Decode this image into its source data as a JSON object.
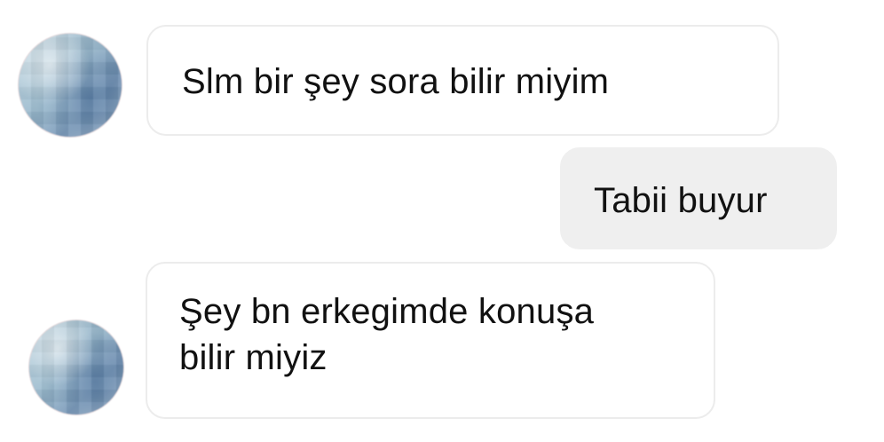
{
  "chat": {
    "messages": [
      {
        "direction": "incoming",
        "lines": [
          "Slm bir şey sora bilir miyim"
        ]
      },
      {
        "direction": "outgoing",
        "lines": [
          "Tabii buyur"
        ]
      },
      {
        "direction": "incoming",
        "lines": [
          "Şey bn erkegimde konuşa",
          "bilir miyiz"
        ]
      }
    ]
  },
  "colors": {
    "incoming_bubble": "#ffffff",
    "incoming_border": "#ececec",
    "outgoing_bubble": "#efefef",
    "text": "#111111"
  }
}
